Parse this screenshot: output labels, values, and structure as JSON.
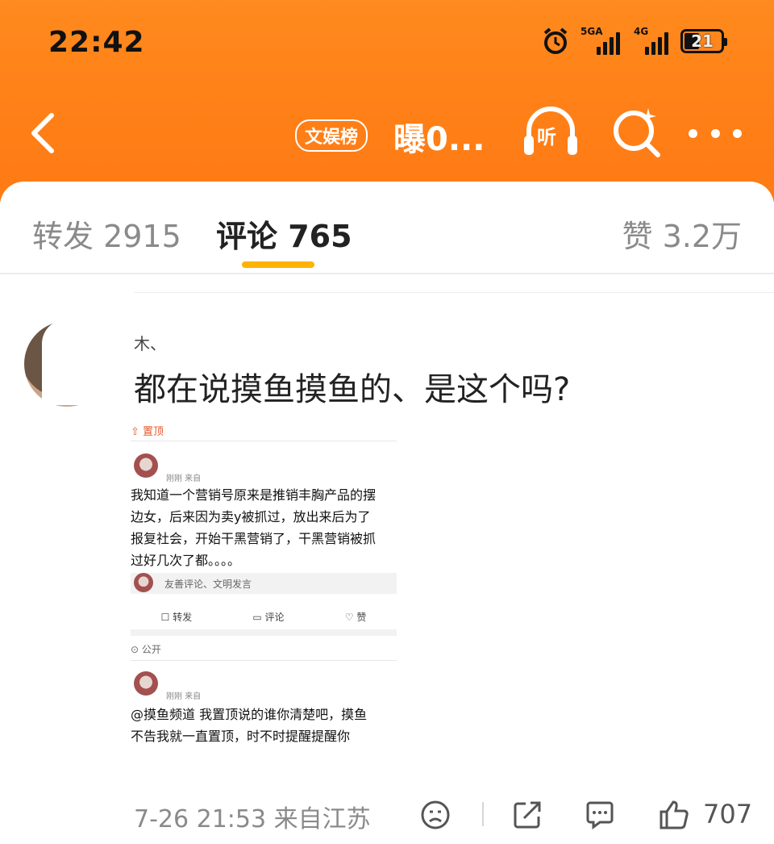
{
  "status_bar": {
    "time": "22:42",
    "signal1_label": "5GA",
    "signal2_label": "4G",
    "battery": "21"
  },
  "nav": {
    "tag": "文娱榜",
    "title": "曝0...",
    "listen_label": "听"
  },
  "tabs": [
    {
      "label": "转发 2915"
    },
    {
      "label": "评论 765"
    },
    {
      "label": "赞 3.2万"
    }
  ],
  "comment": {
    "username": "木、",
    "text": "都在说摸鱼摸鱼的、是这个吗?",
    "timestamp": "7-26 21:53",
    "location": "来自江苏",
    "likes": "707"
  },
  "screenshot": {
    "pinned_label": "置顶",
    "post_meta": "刚刚  来自",
    "post_body_lines": [
      "我知道一个营销号原来是推销丰胸产品的摆",
      "边女，后来因为卖y被抓过，放出来后为了",
      "报复社会，开始干黑营销了，干黑营销被抓",
      "过好几次了都。。。。"
    ],
    "comment_placeholder": "友善评论、文明发言",
    "action_repost": "转发",
    "action_comment": "评论",
    "action_like": "赞",
    "visibility": "公开",
    "post2_meta": "刚刚  来自",
    "post2_lines": [
      "@摸鱼频道 我置顶说的谁你清楚吧，摸鱼",
      "不告我就一直置顶，时不时提醒提醒你"
    ]
  },
  "colors": {
    "header_orange": "#ff8a1e",
    "tab_indicator": "#ffb300",
    "pin_red": "#e8592c"
  }
}
